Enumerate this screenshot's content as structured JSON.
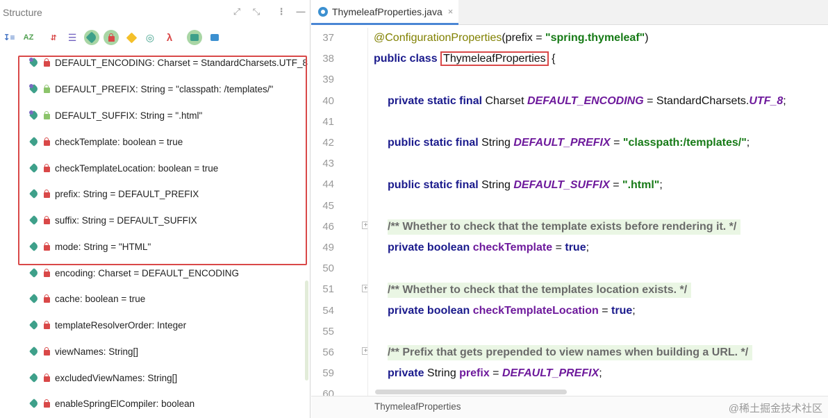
{
  "structure": {
    "title": "Structure",
    "header_buttons": [
      "expand-all",
      "collapse-all",
      "more-options",
      "hide"
    ],
    "toolbar": {
      "sort_visibility_label": "↧≡",
      "sort_alpha_label": "AZ",
      "sort_inherited_label": "⇵"
    },
    "items": [
      {
        "text": "DEFAULT_ENCODING: Charset = StandardCharsets.UTF_8",
        "icon": "static-field-icon",
        "lock": "red"
      },
      {
        "text": "DEFAULT_PREFIX: String = \"classpath: /templates/\"",
        "icon": "static-field-icon",
        "lock": "green"
      },
      {
        "text": "DEFAULT_SUFFIX: String = \".html\"",
        "icon": "static-field-icon",
        "lock": "green"
      },
      {
        "text": "checkTemplate: boolean = true",
        "icon": "field-icon",
        "lock": "red"
      },
      {
        "text": "checkTemplateLocation: boolean = true",
        "icon": "field-icon",
        "lock": "red"
      },
      {
        "text": "prefix: String = DEFAULT_PREFIX",
        "icon": "field-icon",
        "lock": "red"
      },
      {
        "text": "suffix: String = DEFAULT_SUFFIX",
        "icon": "field-icon",
        "lock": "red"
      },
      {
        "text": "mode: String = \"HTML\"",
        "icon": "field-icon",
        "lock": "red"
      },
      {
        "text": "encoding: Charset = DEFAULT_ENCODING",
        "icon": "field-icon",
        "lock": "red"
      },
      {
        "text": "cache: boolean = true",
        "icon": "field-icon",
        "lock": "red"
      },
      {
        "text": "templateResolverOrder: Integer",
        "icon": "field-icon",
        "lock": "red"
      },
      {
        "text": "viewNames: String[]",
        "icon": "field-icon",
        "lock": "red"
      },
      {
        "text": "excludedViewNames: String[]",
        "icon": "field-icon",
        "lock": "red"
      },
      {
        "text": "enableSpringElCompiler: boolean",
        "icon": "field-icon",
        "lock": "red"
      }
    ]
  },
  "editor": {
    "tab": {
      "label": "ThymeleafProperties.java",
      "close": "×"
    },
    "fold_marker": "+",
    "lines": [
      "37",
      "38",
      "39",
      "40",
      "41",
      "42",
      "43",
      "44",
      "45",
      "46",
      "49",
      "50",
      "51",
      "54",
      "55",
      "56",
      "59",
      "60"
    ],
    "code": {
      "l37": {
        "ann": "@ConfigurationProperties",
        "mid": "(prefix = ",
        "str": "\"spring.thymeleaf\"",
        "end": ")"
      },
      "l38": {
        "kw": "public class",
        "cls": "ThymeleafProperties",
        "end": " {"
      },
      "l40": {
        "kw": "private static final",
        "type": " Charset ",
        "fld": "DEFAULT_ENCODING",
        "mid": " = StandardCharsets.",
        "val": "UTF_8",
        "end": ";"
      },
      "l42": {
        "kw": "public static final",
        "type": " String ",
        "fld": "DEFAULT_PREFIX",
        "mid": " = ",
        "str": "\"classpath:/templates/\"",
        "end": ";"
      },
      "l44": {
        "kw": "public static final",
        "type": " String ",
        "fld": "DEFAULT_SUFFIX",
        "mid": " = ",
        "str": "\".html\"",
        "end": ";"
      },
      "l46": {
        "cmt": "/** Whether to check that the template exists before rendering it. */"
      },
      "l49": {
        "kw": "private boolean",
        "fld": " checkTemplate",
        "mid": " = ",
        "val": "true",
        "end": ";"
      },
      "l51": {
        "cmt": "/** Whether to check that the templates location exists. */"
      },
      "l54": {
        "kw": "private boolean",
        "fld": " checkTemplateLocation",
        "mid": " = ",
        "val": "true",
        "end": ";"
      },
      "l56": {
        "cmt": "/** Prefix that gets prepended to view names when building a URL. */"
      },
      "l59": {
        "kw": "private",
        "type": " String ",
        "fld": "prefix",
        "mid": " = ",
        "val": "DEFAULT_PREFIX",
        "end": ";"
      }
    },
    "breadcrumb": "ThymeleafProperties",
    "watermark": "@稀土掘金技术社区"
  }
}
